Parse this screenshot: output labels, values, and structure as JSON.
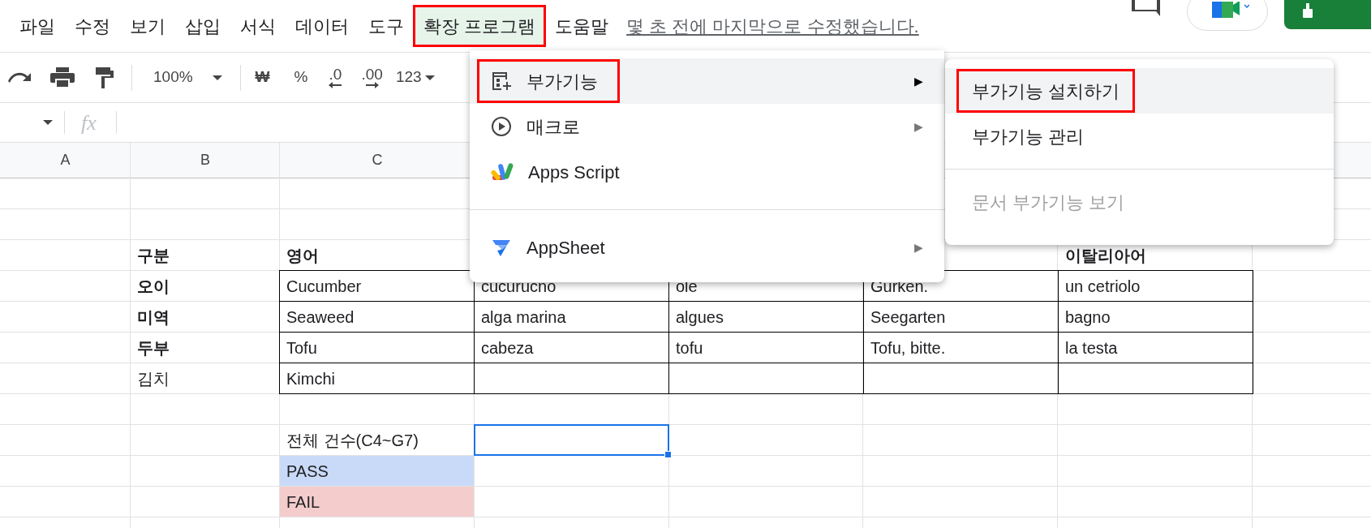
{
  "menubar": {
    "items": [
      {
        "label": "파일",
        "selected": false,
        "annotated": false
      },
      {
        "label": "수정",
        "selected": false,
        "annotated": false
      },
      {
        "label": "보기",
        "selected": false,
        "annotated": false
      },
      {
        "label": "삽입",
        "selected": false,
        "annotated": false
      },
      {
        "label": "서식",
        "selected": false,
        "annotated": false
      },
      {
        "label": "데이터",
        "selected": false,
        "annotated": false
      },
      {
        "label": "도구",
        "selected": false,
        "annotated": false
      },
      {
        "label": "확장 프로그램",
        "selected": true,
        "annotated": true
      },
      {
        "label": "도움말",
        "selected": false,
        "annotated": false
      }
    ],
    "last_edit": "몇 초 전에 마지막으로 수정했습니다."
  },
  "toolbar": {
    "zoom": "100%",
    "currency": "₩",
    "percent": "%",
    "decrease_decimal": ".0",
    "increase_decimal": ".00",
    "number_format": "123"
  },
  "formula_bar": {
    "fx": "fx"
  },
  "columns": [
    "A",
    "B",
    "C"
  ],
  "rows": [
    {},
    {},
    {
      "cells": {
        "B": {
          "text": "구분",
          "bold": true
        },
        "C": {
          "text": "영어",
          "bold": true
        },
        "G": {
          "text": "이탈리아어",
          "bold": true
        }
      }
    },
    {
      "bordered": true,
      "cells": {
        "B": {
          "text": "오이",
          "bold": true
        },
        "C": {
          "text": "Cucumber",
          "bold": false
        },
        "D": {
          "text": "cucurucno",
          "bold": false
        },
        "E": {
          "text": "ole",
          "bold": false
        },
        "F": {
          "text": "Gurken.",
          "bold": false
        },
        "G": {
          "text": "un cetriolo",
          "bold": false
        }
      }
    },
    {
      "bordered": true,
      "cells": {
        "B": {
          "text": "미역",
          "bold": true
        },
        "C": {
          "text": "Seaweed",
          "bold": false
        },
        "D": {
          "text": "alga marina",
          "bold": false
        },
        "E": {
          "text": "algues",
          "bold": false
        },
        "F": {
          "text": "Seegarten",
          "bold": false
        },
        "G": {
          "text": "bagno",
          "bold": false
        }
      }
    },
    {
      "bordered": true,
      "cells": {
        "B": {
          "text": "두부",
          "bold": true
        },
        "C": {
          "text": "Tofu",
          "bold": false
        },
        "D": {
          "text": "cabeza",
          "bold": false
        },
        "E": {
          "text": "tofu",
          "bold": false
        },
        "F": {
          "text": "Tofu, bitte.",
          "bold": false
        },
        "G": {
          "text": "la testa",
          "bold": false
        }
      }
    },
    {
      "bordered": true,
      "cells": {
        "B": {
          "text": "김치",
          "bold": false
        },
        "C": {
          "text": "Kimchi",
          "bold": false
        }
      }
    },
    {},
    {
      "cells": {
        "C": {
          "text": "전체 건수(C4~G7)",
          "bold": false
        },
        "D": {
          "selected": true
        }
      }
    },
    {
      "cells": {
        "C": {
          "text": "PASS",
          "bold": false,
          "color": "#c9daf8"
        }
      }
    },
    {
      "cells": {
        "C": {
          "text": "FAIL",
          "bold": false,
          "color": "#f4cccc"
        }
      }
    }
  ],
  "extensions_menu": {
    "items": [
      {
        "kind": "item",
        "label": "부가기능",
        "arrow": "▶",
        "highlighted": true,
        "annotated": true
      },
      {
        "kind": "item",
        "label": "매크로",
        "arrow": "▶",
        "highlighted": false,
        "annotated": false
      },
      {
        "kind": "item",
        "label": "Apps Script",
        "highlighted": false,
        "annotated": false
      },
      {
        "kind": "divider"
      },
      {
        "kind": "item",
        "label": "AppSheet",
        "arrow": "▶",
        "highlighted": false,
        "annotated": false
      }
    ]
  },
  "addons_submenu": {
    "items": [
      {
        "kind": "item",
        "label": "부가기능 설치하기",
        "highlighted": true,
        "annotated": true,
        "disabled": false
      },
      {
        "kind": "item",
        "label": "부가기능 관리",
        "highlighted": false,
        "annotated": false,
        "disabled": false
      },
      {
        "kind": "divider"
      },
      {
        "kind": "item",
        "label": "문서 부가기능 보기",
        "highlighted": false,
        "annotated": false,
        "disabled": true
      }
    ]
  }
}
